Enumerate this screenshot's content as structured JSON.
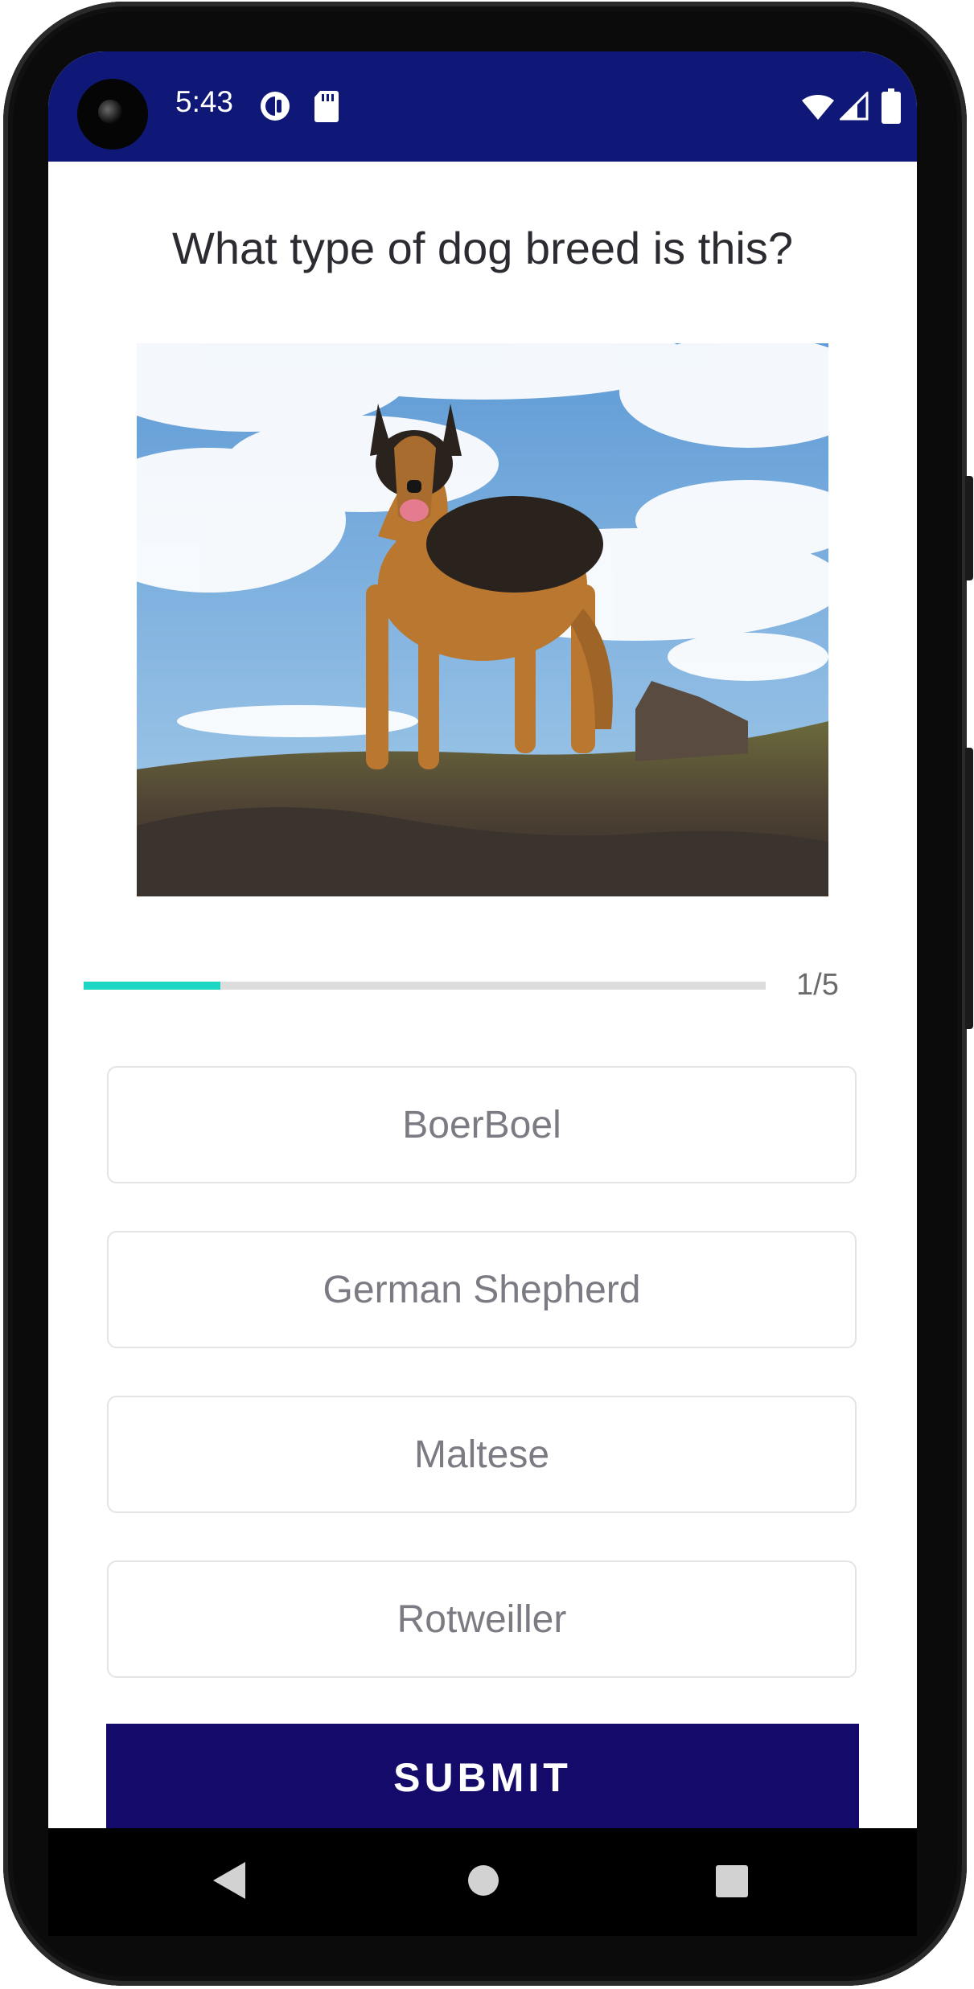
{
  "status_bar": {
    "time": "5:43",
    "background_color": "#0f1876",
    "icons": [
      "data-saver-icon",
      "sd-card-icon",
      "wifi-icon",
      "cellular-signal-icon",
      "battery-icon"
    ]
  },
  "quiz": {
    "question": "What type of dog breed is this?",
    "image_subject": "German Shepherd standing on a rocky hill under a cloudy blue sky",
    "progress": {
      "current": 1,
      "total": 5,
      "label": "1/5",
      "fill_fraction": 0.2,
      "fill_color": "#1dd6c4"
    },
    "options": [
      {
        "label": "BoerBoel"
      },
      {
        "label": "German Shepherd"
      },
      {
        "label": "Maltese"
      },
      {
        "label": "Rotweiller"
      }
    ],
    "submit_label": "SUBMIT",
    "submit_color": "#140a6a"
  },
  "nav_bar": {
    "icons": [
      "back-icon",
      "home-icon",
      "recents-icon"
    ]
  }
}
